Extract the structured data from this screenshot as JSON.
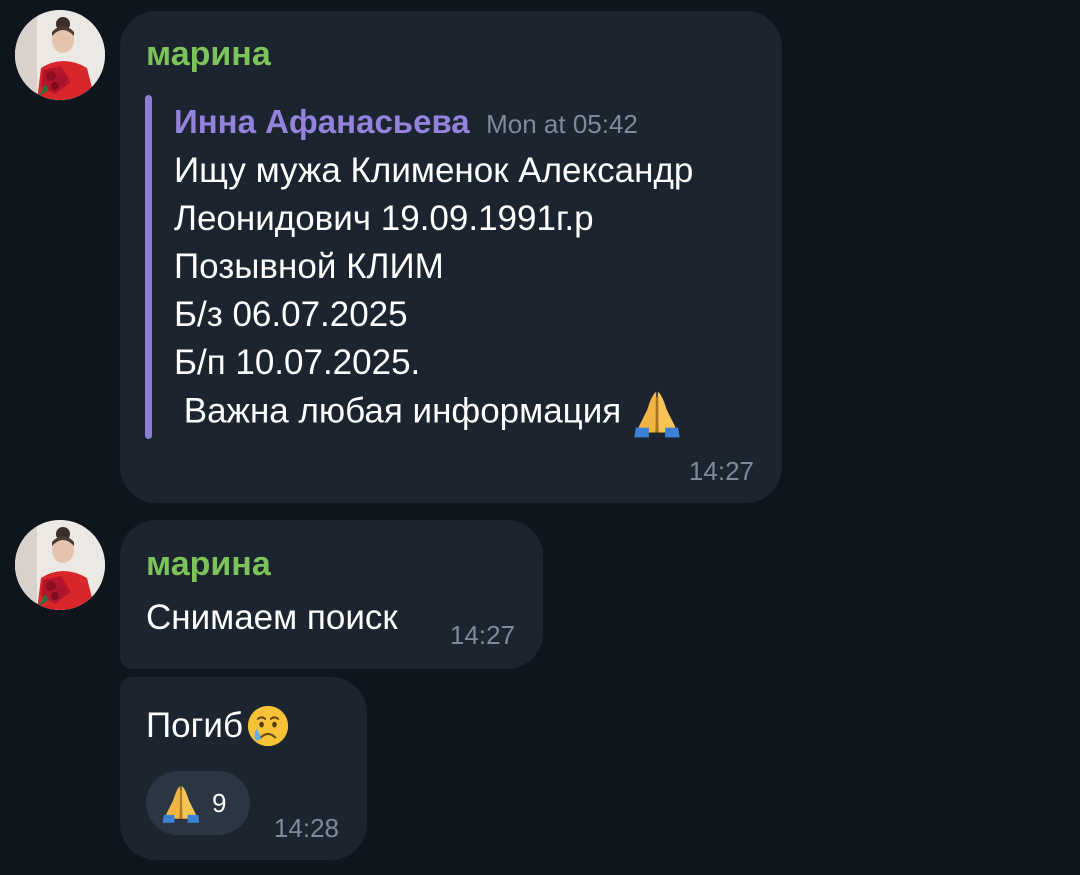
{
  "messages": [
    {
      "sender": "марина",
      "quote": {
        "author": "Инна Афанасьева",
        "date": "Mon at 05:42",
        "lines": [
          "Ищу мужа Клименок Александр",
          "Леонидович 19.09.1991г.р",
          "Позывной КЛИМ",
          "Б/з 06.07.2025",
          "Б/п 10.07.2025.",
          " Важна любая информация"
        ],
        "trailing_emoji": "folded-hands-emoji"
      },
      "time": "14:27"
    },
    {
      "sender": "марина",
      "text": "Снимаем поиск",
      "time": "14:27"
    },
    {
      "text": "Погиб",
      "trailing_emoji": "crying-face-emoji",
      "reaction": {
        "icon": "folded-hands-emoji",
        "count": "9"
      },
      "time": "14:28"
    }
  ],
  "colors": {
    "background": "#0f151d",
    "bubble": "#1c242f",
    "sender_name": "#7cc35a",
    "quote_accent": "#8c7ed6",
    "quote_author": "#9483dc",
    "meta_text": "#7f8a98",
    "reaction_bg": "#2c3542"
  }
}
